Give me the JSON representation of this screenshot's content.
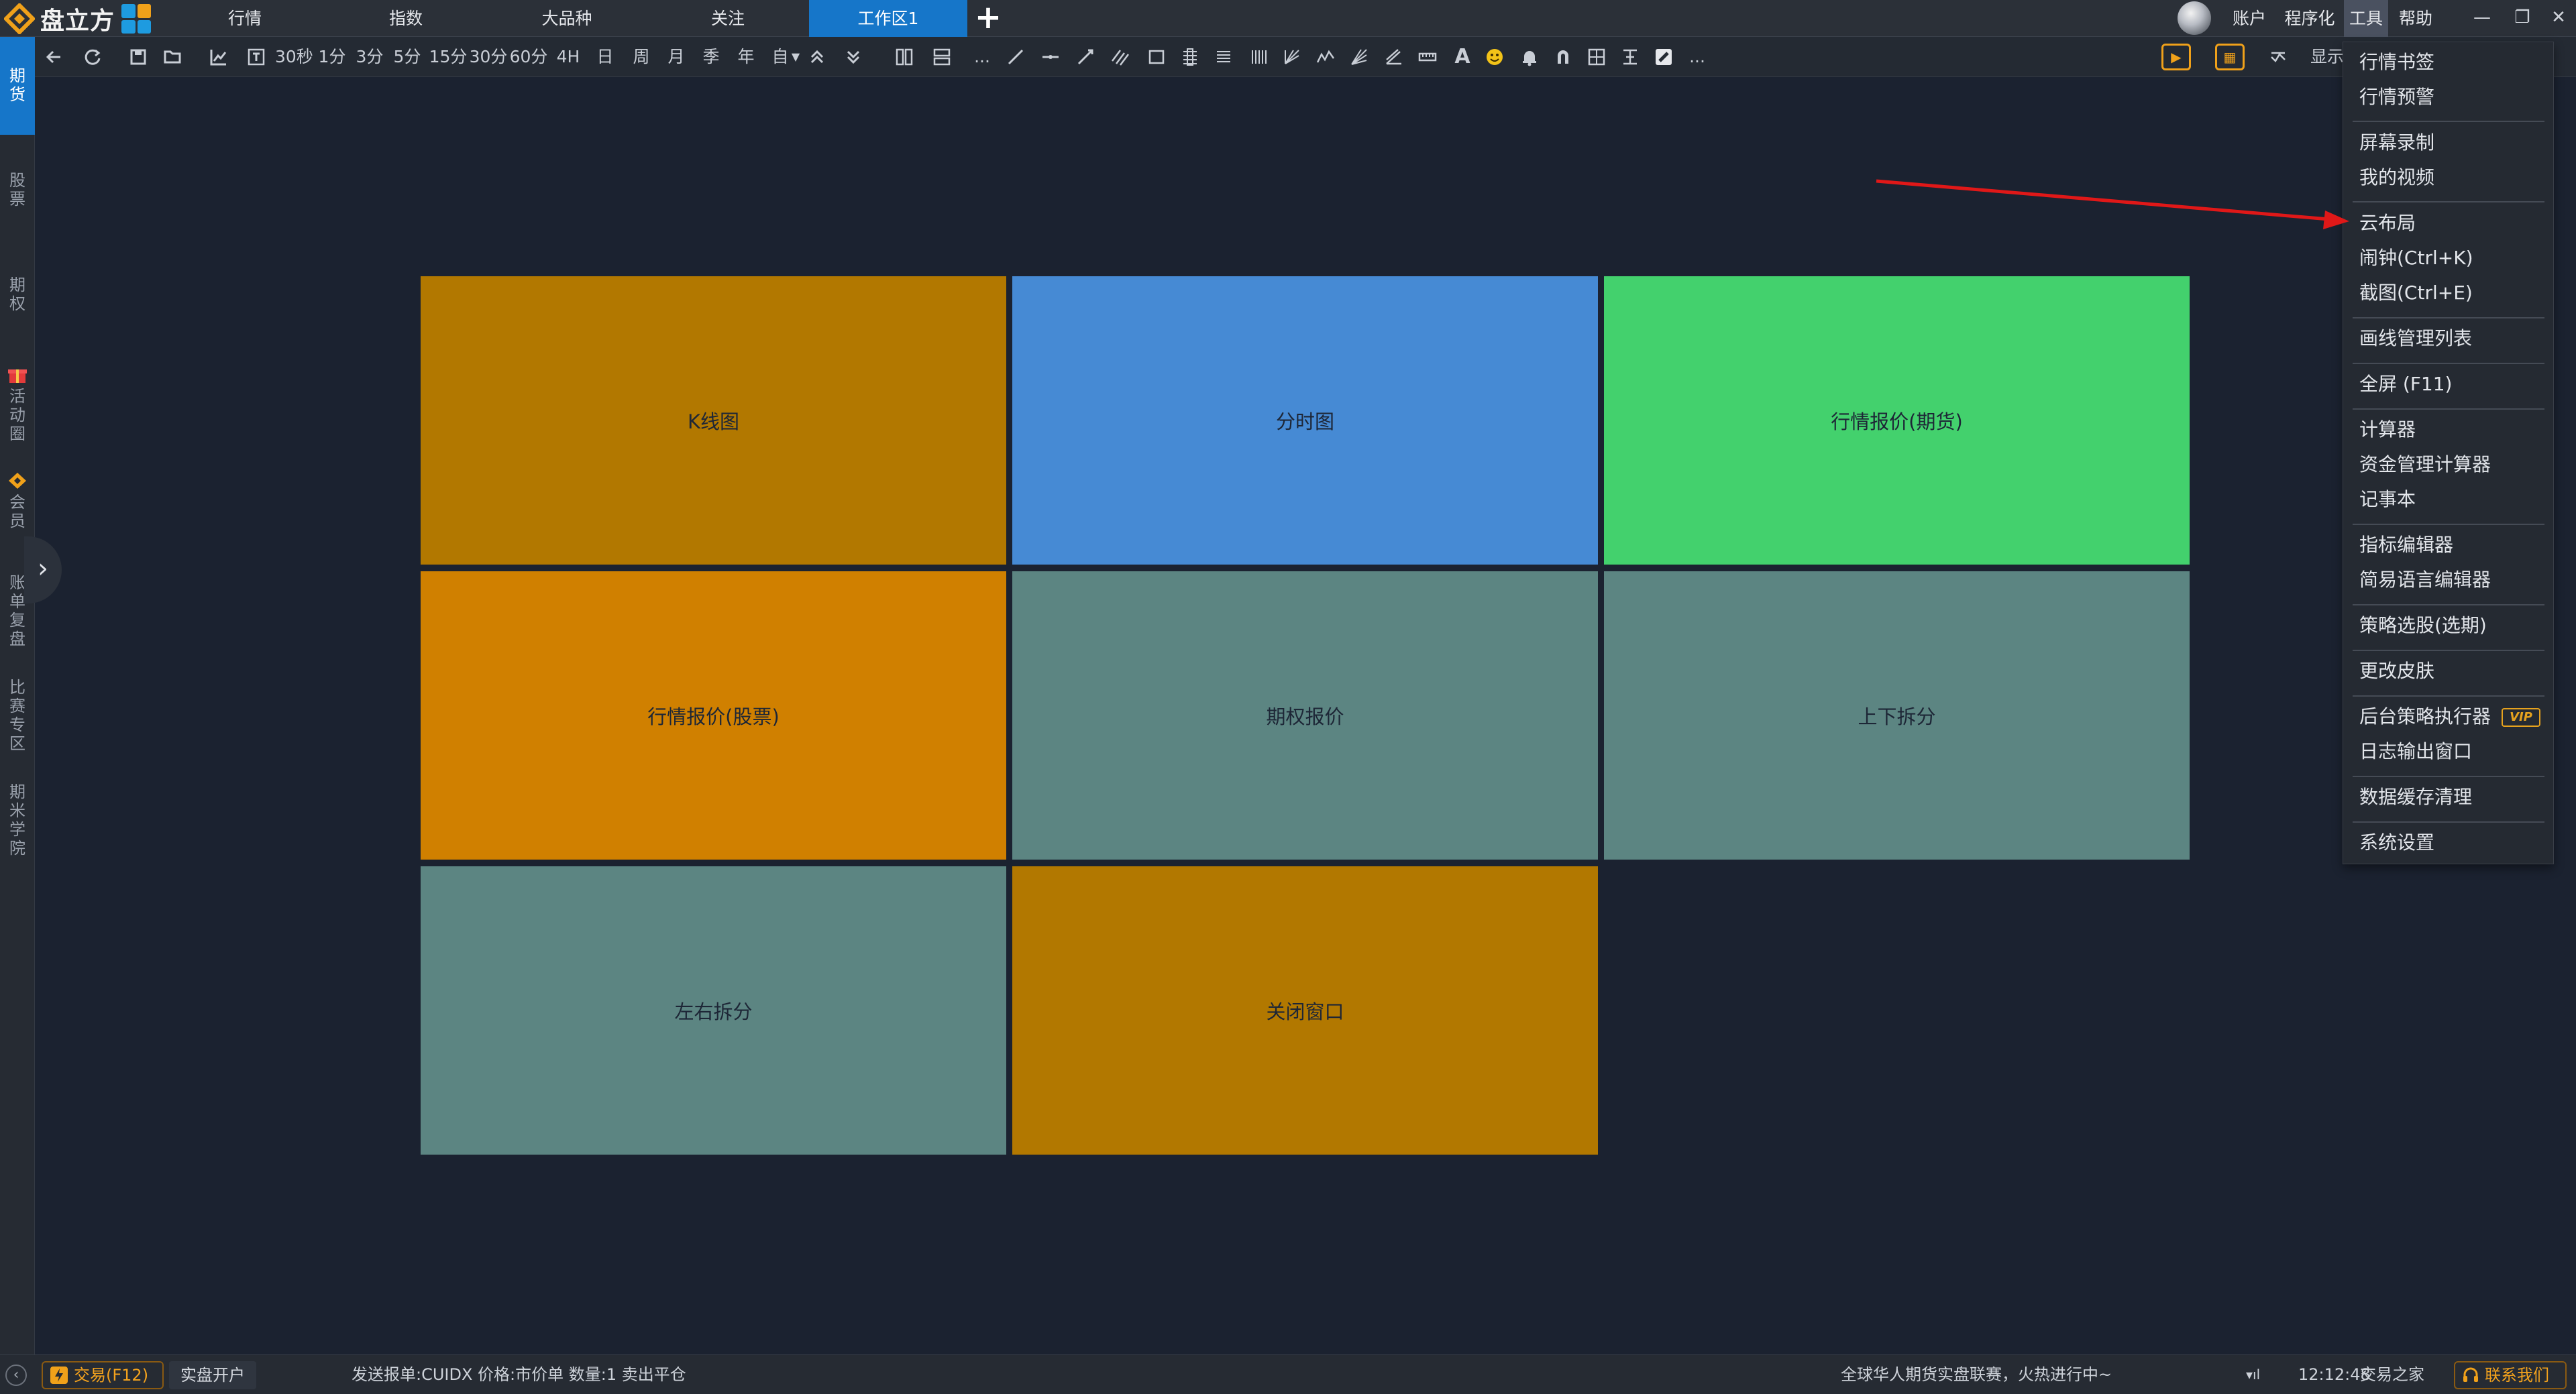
{
  "app": {
    "name": "盘立方",
    "colors": {
      "accent": "#1676c9",
      "logo_orange": "#f0a11a",
      "bg": "#1b2230"
    }
  },
  "menu": {
    "tabs": [
      {
        "label": "行情"
      },
      {
        "label": "指数"
      },
      {
        "label": "大品种"
      },
      {
        "label": "关注"
      },
      {
        "label": "工作区1",
        "active": true
      }
    ],
    "add_icon": "plus-icon",
    "right_items": [
      {
        "label": "账户"
      },
      {
        "label": "程序化"
      },
      {
        "label": "工具",
        "active": true
      },
      {
        "label": "帮助"
      }
    ],
    "window_controls": [
      "minimize-icon",
      "restore-icon",
      "close-icon"
    ]
  },
  "toolbar": {
    "periods": [
      "30秒",
      "1分",
      "3分",
      "5分",
      "15分",
      "30分",
      "60分",
      "4H",
      "日",
      "周",
      "月",
      "季",
      "年",
      "自"
    ],
    "more_label": "...",
    "more_label_2": "...",
    "right_label": "显示"
  },
  "sidebar": {
    "items": [
      {
        "label": "期货",
        "active": true
      },
      {
        "label": "股票"
      },
      {
        "label": "期权"
      },
      {
        "label": "活动圈",
        "icon": "gift-icon"
      },
      {
        "label": "会员",
        "icon": "vip-diamond-icon"
      },
      {
        "label": "账单复盘"
      },
      {
        "label": "比赛专区"
      },
      {
        "label": "期米学院"
      }
    ],
    "toggle_icon": "chevron-right-icon"
  },
  "layout_tiles": [
    {
      "label": "K线图",
      "color": "#b27800"
    },
    {
      "label": "分时图",
      "color": "#468ad4"
    },
    {
      "label": "行情报价(期货)",
      "color": "#43d16d"
    },
    {
      "label": "行情报价(股票)",
      "color": "#d08000"
    },
    {
      "label": "期权报价",
      "color": "#5c8582"
    },
    {
      "label": "上下拆分",
      "color": "#5c8582"
    },
    {
      "label": "左右拆分",
      "color": "#5c8582"
    },
    {
      "label": "关闭窗口",
      "color": "#b27800"
    }
  ],
  "tools_menu": {
    "groups": [
      [
        "行情书签",
        "行情预警"
      ],
      [
        "屏幕录制",
        "我的视频"
      ],
      [
        "云布局",
        "闹钟(Ctrl+K)",
        "截图(Ctrl+E)"
      ],
      [
        "画线管理列表"
      ],
      [
        "全屏 (F11)"
      ],
      [
        "计算器",
        "资金管理计算器",
        "记事本"
      ],
      [
        "指标编辑器",
        "简易语言编辑器"
      ],
      [
        "策略选股(选期)"
      ],
      [
        "更改皮肤"
      ],
      [
        "后台策略执行器",
        "日志输出窗口"
      ],
      [
        "数据缓存清理"
      ],
      [
        "系统设置"
      ]
    ],
    "vip_badge": "VIP",
    "highlighted_item": "云布局",
    "arrow_color": "#e01818"
  },
  "statusbar": {
    "trade_button": "交易(F12)",
    "open_account": "实盘开户",
    "order_info": "发送报单:CUIDX 价格:市价单  数量:1 卖出平仓",
    "ticker": "全球华人期货实盘联赛，火热进行中~",
    "time": "12:12:48",
    "trade_home": "交易之家",
    "contact": "联系我们"
  }
}
